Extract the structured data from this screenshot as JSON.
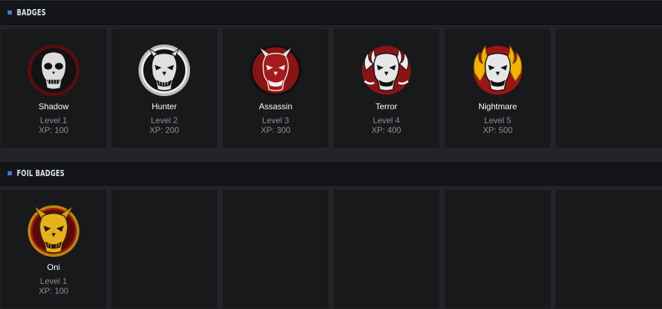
{
  "sections": [
    {
      "title": "BADGES",
      "badges": [
        {
          "name": "Shadow",
          "level": "Level 1",
          "xp": "XP: 100",
          "icon": "shadow-demon-mask-icon"
        },
        {
          "name": "Hunter",
          "level": "Level 2",
          "xp": "XP: 200",
          "icon": "hunter-demon-mask-icon"
        },
        {
          "name": "Assassin",
          "level": "Level 3",
          "xp": "XP: 300",
          "icon": "assassin-demon-mask-icon"
        },
        {
          "name": "Terror",
          "level": "Level 4",
          "xp": "XP: 400",
          "icon": "terror-demon-mask-icon"
        },
        {
          "name": "Nightmare",
          "level": "Level 5",
          "xp": "XP: 500",
          "icon": "nightmare-demon-mask-icon"
        }
      ]
    },
    {
      "title": "FOIL BADGES",
      "badges": [
        {
          "name": "Oni",
          "level": "Level 1",
          "xp": "XP: 100",
          "icon": "oni-demon-mask-icon"
        }
      ]
    }
  ],
  "colors": {
    "accent": "#3a7bd5",
    "ring_dark_red": "#6e0f0f",
    "ring_red": "#9c1515",
    "ring_gold": "#c89a10"
  }
}
